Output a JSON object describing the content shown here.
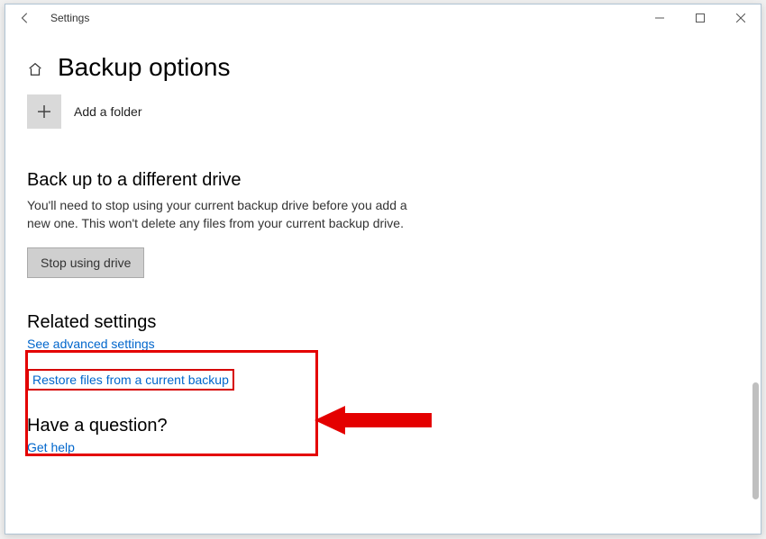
{
  "window": {
    "title": "Settings"
  },
  "header": {
    "page_title": "Backup options",
    "add_folder_label": "Add a folder"
  },
  "backup_drive": {
    "heading": "Back up to a different drive",
    "description": "You'll need to stop using your current backup drive before you add a new one. This won't delete any files from your current backup drive.",
    "button_label": "Stop using drive"
  },
  "related": {
    "heading": "Related settings",
    "advanced_label": "See advanced settings",
    "restore_label": "Restore files from a current backup"
  },
  "question": {
    "heading": "Have a question?",
    "help_label": "Get help"
  }
}
